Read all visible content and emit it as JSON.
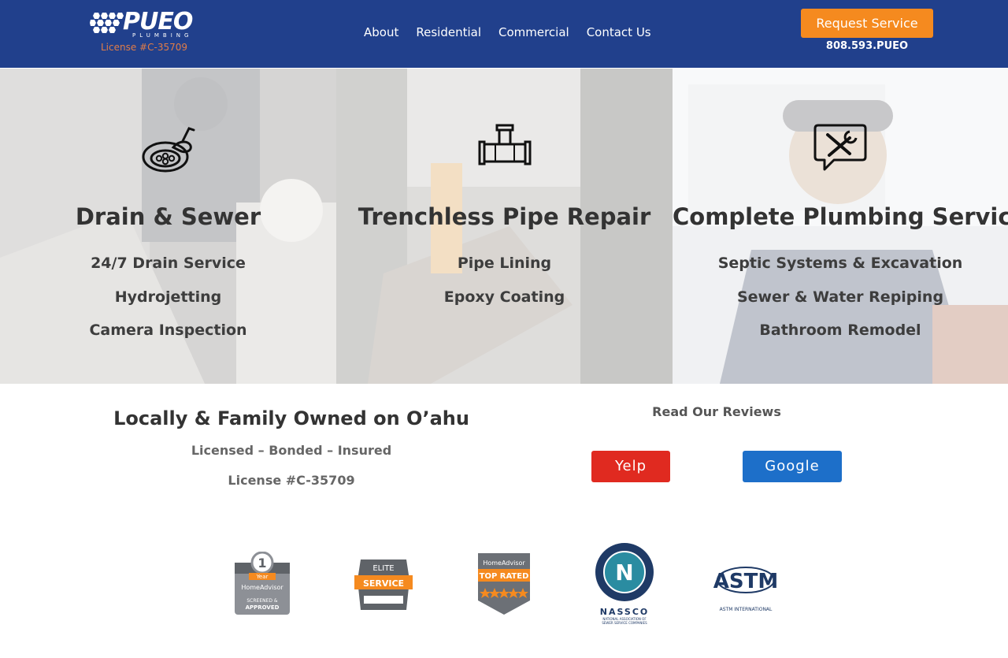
{
  "header": {
    "logo_text": "PUEO",
    "logo_subtext": "PLUMBING",
    "license_text": "License #C-35709",
    "nav": [
      {
        "label": "About"
      },
      {
        "label": "Residential"
      },
      {
        "label": "Commercial"
      },
      {
        "label": "Contact Us"
      }
    ],
    "request_button": "Request Service",
    "phone": "808.593.PUEO"
  },
  "services": [
    {
      "icon": "drain-icon",
      "title": "Drain & Sewer",
      "items": [
        "24/7 Drain Service",
        "Hydrojetting",
        "Camera Inspection"
      ]
    },
    {
      "icon": "pipe-icon",
      "title": "Trenchless Pipe Repair",
      "items": [
        "Pipe Lining",
        "Epoxy Coating"
      ]
    },
    {
      "icon": "tools-chat-icon",
      "title": "Complete Plumbing Service",
      "items": [
        "Septic Systems & Excavation",
        "Sewer & Water Repiping",
        "Bathroom Remodel"
      ]
    }
  ],
  "info": {
    "heading": "Locally & Family Owned on O’ahu",
    "sub": "Licensed – Bonded – Insured",
    "license": "License #C-35709"
  },
  "reviews": {
    "title": "Read Our Reviews",
    "yelp": "Yelp",
    "google": "Google"
  },
  "badges": [
    {
      "icon": "homeadvisor-screened-badge",
      "text": [
        "1",
        "Year",
        "HomeAdvisor",
        "SCREENED &",
        "APPROVED"
      ]
    },
    {
      "icon": "elite-service-badge",
      "text": [
        "ELITE",
        "SERVICE"
      ]
    },
    {
      "icon": "top-rated-badge",
      "text": [
        "HomeAdvisor",
        "TOP RATED"
      ]
    },
    {
      "icon": "nassco-logo",
      "text": [
        "N",
        "NASSCO",
        "NATIONAL ASSOCIATION OF",
        "SEWER SERVICE COMPANIES"
      ]
    },
    {
      "icon": "astm-logo",
      "text": [
        "ASTM",
        "ASTM INTERNATIONAL"
      ]
    }
  ],
  "colors": {
    "header_bg": "#21408c",
    "accent_orange": "#f58a1f",
    "yelp_red": "#e02a20",
    "google_blue": "#1d6fc9",
    "text_dark": "#333333"
  }
}
